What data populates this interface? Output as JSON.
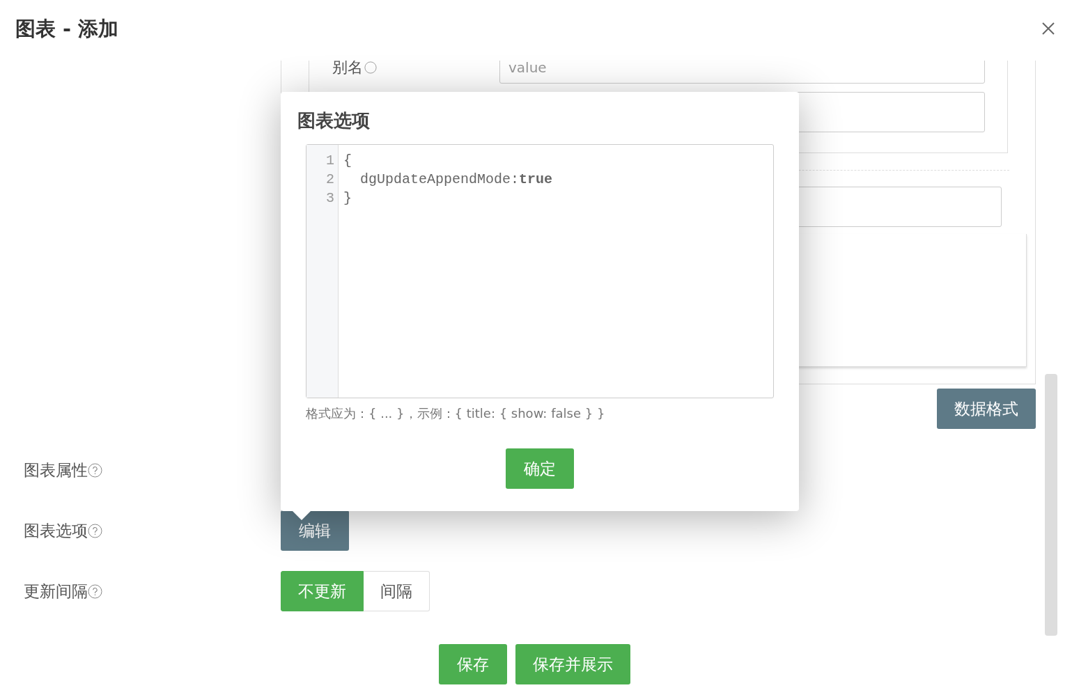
{
  "dialog": {
    "title": "图表 - 添加"
  },
  "series_panel": {
    "alias_label": "别名",
    "alias_placeholder": "value"
  },
  "data_format_button": "数据格式",
  "form_rows": [
    {
      "kind": "plain",
      "label": "图表属性"
    },
    {
      "kind": "button",
      "label": "图表选项",
      "button": "编辑"
    },
    {
      "kind": "toggle",
      "label": "更新间隔",
      "options": [
        {
          "label": "不更新",
          "selected": true
        },
        {
          "label": "间隔",
          "selected": false
        }
      ]
    }
  ],
  "footer_buttons": [
    "保存",
    "保存并展示"
  ],
  "popover": {
    "title": "图表选项",
    "code_lines": [
      {
        "number": "1",
        "text": "{"
      },
      {
        "number": "2",
        "text": "  dgUpdateAppendMode:**true**"
      },
      {
        "number": "3",
        "text": "}"
      }
    ],
    "hint": "格式应为：{ ... }，示例：{ title: { show: false } }",
    "confirm_button": "确定"
  }
}
